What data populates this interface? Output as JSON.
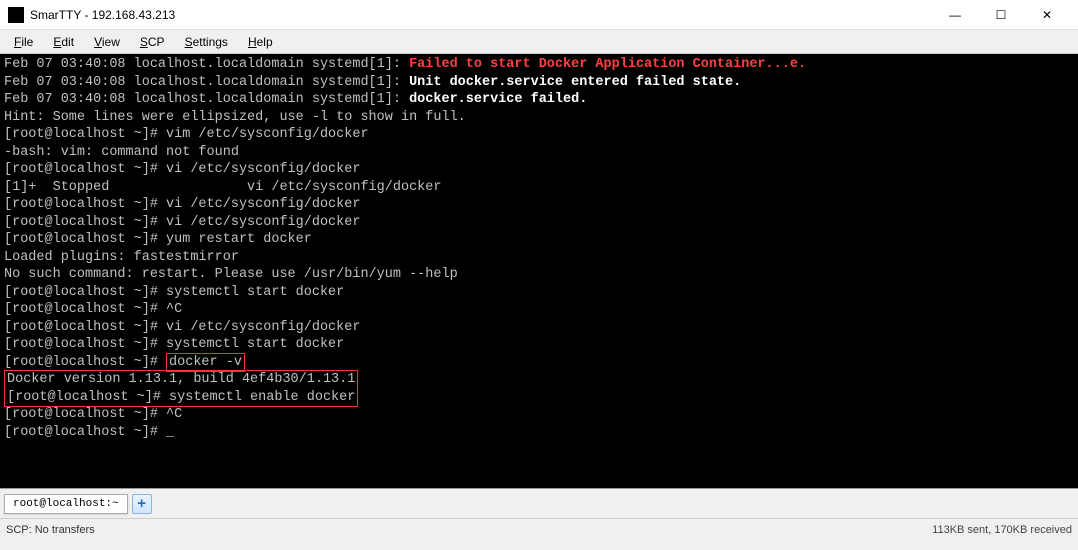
{
  "titlebar": {
    "app_name": "SmarTTY",
    "host": "192.168.43.213",
    "full_title": "SmarTTY - 192.168.43.213"
  },
  "window_controls": {
    "minimize": "—",
    "maximize": "☐",
    "close": "✕"
  },
  "menubar": {
    "file": "File",
    "edit": "Edit",
    "view": "View",
    "scp": "SCP",
    "settings": "Settings",
    "help": "Help"
  },
  "terminal": {
    "lines": [
      {
        "segments": [
          {
            "c": "grey",
            "t": "Feb 07 03:40:08 localhost.localdomain systemd[1]: "
          },
          {
            "c": "red",
            "t": "Failed to start Docker Application Container...e."
          }
        ]
      },
      {
        "segments": [
          {
            "c": "grey",
            "t": "Feb 07 03:40:08 localhost.localdomain systemd[1]: "
          },
          {
            "c": "white",
            "t": "Unit docker.service entered failed state."
          }
        ]
      },
      {
        "segments": [
          {
            "c": "grey",
            "t": "Feb 07 03:40:08 localhost.localdomain systemd[1]: "
          },
          {
            "c": "white",
            "t": "docker.service failed."
          }
        ]
      },
      {
        "segments": [
          {
            "c": "grey",
            "t": "Hint: Some lines were ellipsized, use -l to show in full."
          }
        ]
      },
      {
        "segments": [
          {
            "c": "grey",
            "t": "[root@localhost ~]# vim /etc/sysconfig/docker"
          }
        ]
      },
      {
        "segments": [
          {
            "c": "grey",
            "t": "-bash: vim: command not found"
          }
        ]
      },
      {
        "segments": [
          {
            "c": "grey",
            "t": "[root@localhost ~]# vi /etc/sysconfig/docker"
          }
        ]
      },
      {
        "segments": [
          {
            "c": "grey",
            "t": ""
          }
        ]
      },
      {
        "segments": [
          {
            "c": "grey",
            "t": "[1]+  Stopped                 vi /etc/sysconfig/docker"
          }
        ]
      },
      {
        "segments": [
          {
            "c": "grey",
            "t": "[root@localhost ~]# vi /etc/sysconfig/docker"
          }
        ]
      },
      {
        "segments": [
          {
            "c": "grey",
            "t": "[root@localhost ~]# vi /etc/sysconfig/docker"
          }
        ]
      },
      {
        "segments": [
          {
            "c": "grey",
            "t": "[root@localhost ~]# yum restart docker"
          }
        ]
      },
      {
        "segments": [
          {
            "c": "grey",
            "t": "Loaded plugins: fastestmirror"
          }
        ]
      },
      {
        "segments": [
          {
            "c": "grey",
            "t": "No such command: restart. Please use /usr/bin/yum --help"
          }
        ]
      },
      {
        "segments": [
          {
            "c": "grey",
            "t": "[root@localhost ~]# systemctl start docker"
          }
        ]
      },
      {
        "segments": [
          {
            "c": "grey",
            "t": "[root@localhost ~]# ^C"
          }
        ]
      },
      {
        "segments": [
          {
            "c": "grey",
            "t": "[root@localhost ~]# vi /etc/sysconfig/docker"
          }
        ]
      },
      {
        "segments": [
          {
            "c": "grey",
            "t": "[root@localhost ~]# systemctl start docker"
          }
        ]
      }
    ],
    "boxed_lines": [
      {
        "prompt": "[root@localhost ~]# ",
        "cmd": "docker -v"
      },
      {
        "output": "Docker version 1.13.1, build 4ef4b30/1.13.1"
      },
      {
        "prompt": "[root@localhost ~]# ",
        "cmd": "systemctl enable docker"
      }
    ],
    "after_box": [
      {
        "segments": [
          {
            "c": "grey",
            "t": "[root@localhost ~]# ^C"
          }
        ]
      },
      {
        "segments": [
          {
            "c": "grey",
            "t": "[root@localhost ~]# "
          }
        ]
      }
    ]
  },
  "tabs": {
    "tab1": "root@localhost:~",
    "plus": "+"
  },
  "statusbar": {
    "left": "SCP: No transfers",
    "right": "113KB sent, 170KB received"
  }
}
